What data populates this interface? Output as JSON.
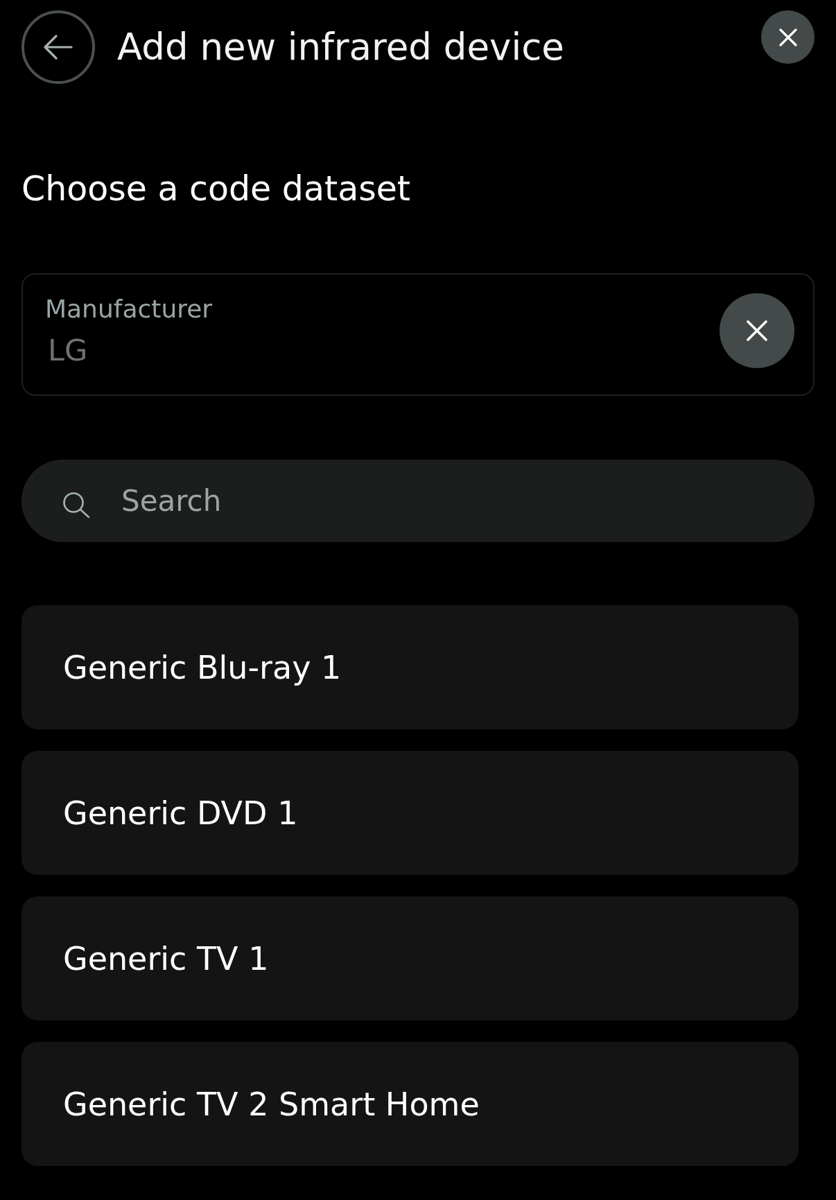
{
  "header": {
    "title": "Add new infrared device"
  },
  "section": {
    "heading": "Choose a code dataset"
  },
  "manufacturer_field": {
    "label": "Manufacturer",
    "value": "LG"
  },
  "search": {
    "placeholder": "Search"
  },
  "datasets": [
    {
      "label": "Generic Blu-ray 1"
    },
    {
      "label": "Generic DVD 1"
    },
    {
      "label": "Generic TV 1"
    },
    {
      "label": "Generic TV 2 Smart Home"
    }
  ]
}
